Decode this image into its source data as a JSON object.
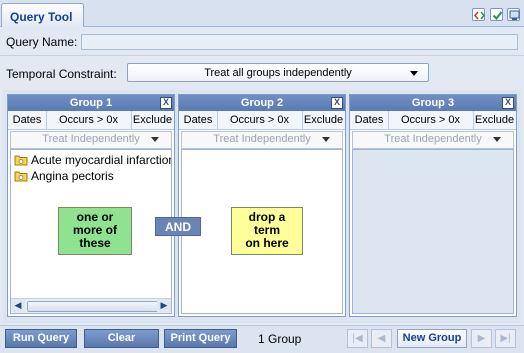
{
  "tab": {
    "title": "Query Tool"
  },
  "toolbar": {
    "icons": [
      "code-view-icon",
      "check-icon",
      "window-icon"
    ]
  },
  "query_name": {
    "label": "Query Name:",
    "value": ""
  },
  "temporal": {
    "label": "Temporal Constraint:",
    "selected": "Treat all groups independently"
  },
  "groups": [
    {
      "title": "Group 1",
      "close": "X",
      "buttons": {
        "dates": "Dates",
        "occurs": "Occurs > 0x",
        "exclude": "Exclude"
      },
      "timing": "Treat Independently",
      "terms": [
        "Acute myocardial infarction",
        "Angina pectoris"
      ],
      "hint": "one or\nmore of\nthese"
    },
    {
      "title": "Group 2",
      "close": "X",
      "buttons": {
        "dates": "Dates",
        "occurs": "Occurs > 0x",
        "exclude": "Exclude"
      },
      "timing": "Treat Independently",
      "terms": [],
      "hint": "drop a\nterm\non here"
    },
    {
      "title": "Group 3",
      "close": "X",
      "buttons": {
        "dates": "Dates",
        "occurs": "Occurs > 0x",
        "exclude": "Exclude"
      },
      "timing": "Treat Independently",
      "terms": []
    }
  ],
  "connector": "AND",
  "bottom": {
    "run": "Run Query",
    "clear": "Clear",
    "print": "Print Query",
    "group_count": "1 Group",
    "first": "|◀",
    "prev": "◀",
    "new_group": "New Group",
    "next": "▶",
    "last": "▶|"
  },
  "colors": {
    "accent": "#5b78ae",
    "hint_green": "#8fe28f",
    "hint_yellow": "#ffff99"
  }
}
